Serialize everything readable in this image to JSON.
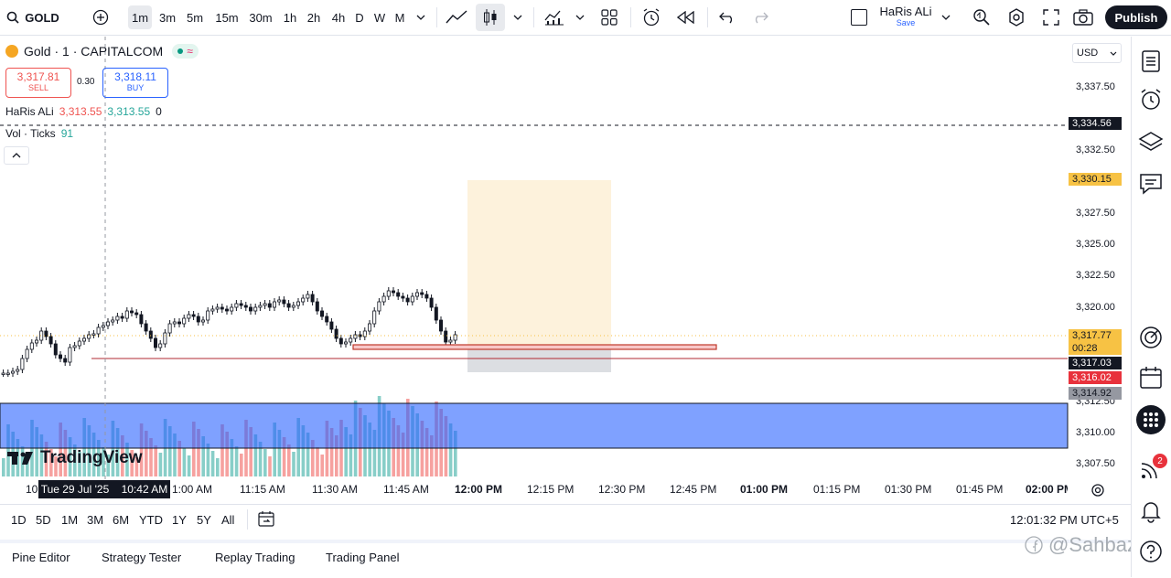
{
  "toolbar": {
    "symbol": "GOLD",
    "timeframes": [
      "1m",
      "3m",
      "5m",
      "15m",
      "30m",
      "1h",
      "2h",
      "4h",
      "D",
      "W",
      "M"
    ],
    "active_timeframe": "1m",
    "user_name": "HaRis ALi",
    "save_label": "Save",
    "publish_label": "Publish"
  },
  "legend": {
    "title": "Gold · 1 · CAPITALCOM",
    "sell_price": "3,317.81",
    "sell_label": "SELL",
    "spread": "0.30",
    "buy_price": "3,318.11",
    "buy_label": "BUY",
    "indicator_name": "HaRis ALi",
    "indicator_val1": "3,313.55",
    "indicator_val2": "3,313.55",
    "indicator_val3": "0",
    "vol_name": "Vol · Ticks",
    "vol_value": "91"
  },
  "price_axis": {
    "currency": "USD",
    "ticks": [
      "3,337.50",
      "3,332.50",
      "3,327.50",
      "3,325.00",
      "3,322.50",
      "3,320.00",
      "3,312.50",
      "3,310.00",
      "3,307.50"
    ],
    "tags": [
      {
        "text": "3,334.56",
        "bg": "#131722",
        "fg": "#ffffff"
      },
      {
        "text": "3,330.15",
        "bg": "#f7c244",
        "fg": "#131722"
      },
      {
        "text": "3,317.77",
        "bg": "#f7c244",
        "fg": "#131722"
      },
      {
        "text": "00:28",
        "bg": "#f7c244",
        "fg": "#131722"
      },
      {
        "text": "3,317.03",
        "bg": "#131722",
        "fg": "#ffffff"
      },
      {
        "text": "3,316.02",
        "bg": "#e8323c",
        "fg": "#ffffff"
      },
      {
        "text": "3,314.92",
        "bg": "#9598a1",
        "fg": "#131722"
      }
    ]
  },
  "time_axis": {
    "labels": [
      "10",
      "1:00 AM",
      "11:15 AM",
      "11:30 AM",
      "11:45 AM",
      "12:00 PM",
      "12:15 PM",
      "12:30 PM",
      "12:45 PM",
      "01:00 PM",
      "01:15 PM",
      "01:30 PM",
      "01:45 PM",
      "02:00 PM"
    ],
    "crosshair_label": "Tue 29 Jul '25    10:42 AM"
  },
  "logo_text": "TradingView",
  "ranges": [
    "1D",
    "5D",
    "1M",
    "3M",
    "6M",
    "YTD",
    "1Y",
    "5Y",
    "All"
  ],
  "clock": "12:01:32 PM UTC+5",
  "panels": [
    "Pine Editor",
    "Strategy Tester",
    "Replay Trading",
    "Trading Panel"
  ],
  "watermark": "@Sahbaz",
  "notification_count": "2",
  "colors": {
    "up": "#26a69a",
    "down": "#ef5350",
    "zone": "#2962ff",
    "accent": "#f7c244"
  }
}
